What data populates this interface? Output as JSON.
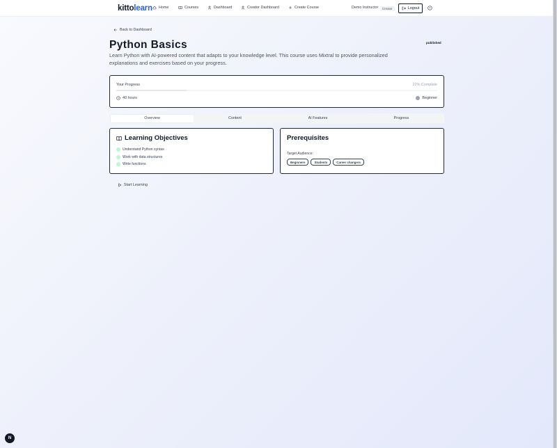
{
  "header": {
    "logo": {
      "part1": "kitto",
      "part2": "learn"
    },
    "nav": [
      {
        "label": "Home",
        "icon": "home-icon"
      },
      {
        "label": "Courses",
        "icon": "book-icon"
      },
      {
        "label": "Dashboard",
        "icon": "user-icon"
      },
      {
        "label": "Creator Dashboard",
        "icon": "user-icon"
      },
      {
        "label": "Create Course",
        "icon": "plus-icon"
      }
    ],
    "user_name": "Demo Instructor",
    "role": "Creator",
    "logout_label": "Logout"
  },
  "back_link": "Back to Dashboard",
  "course": {
    "title": "Python Basics",
    "status": "published",
    "description": "Learn Python with AI-powered content that adapts to your knowledge level. This course uses Mixtral to provide personalized explanations and exercises based on your progress."
  },
  "progress": {
    "label": "Your Progress",
    "percent_text": "22% Complete",
    "percent": 22,
    "duration": "40 hours",
    "level": "Beginner"
  },
  "tabs": [
    "Overview",
    "Content",
    "AI Features",
    "Progress"
  ],
  "objectives": {
    "heading": "Learning Objectives",
    "items": [
      "Understand Python syntax",
      "Work with data structures",
      "Write functions"
    ]
  },
  "prerequisites": {
    "heading": "Prerequisites",
    "audience_label": "Target Audience:",
    "audience": [
      "Beginners",
      "Students",
      "Career changers"
    ]
  },
  "start_label": "Start Learning",
  "fab_letter": "N",
  "colors": {
    "brand_accent": "#2563eb",
    "text_dark": "#111827",
    "check_green": "#bbf7d0"
  }
}
